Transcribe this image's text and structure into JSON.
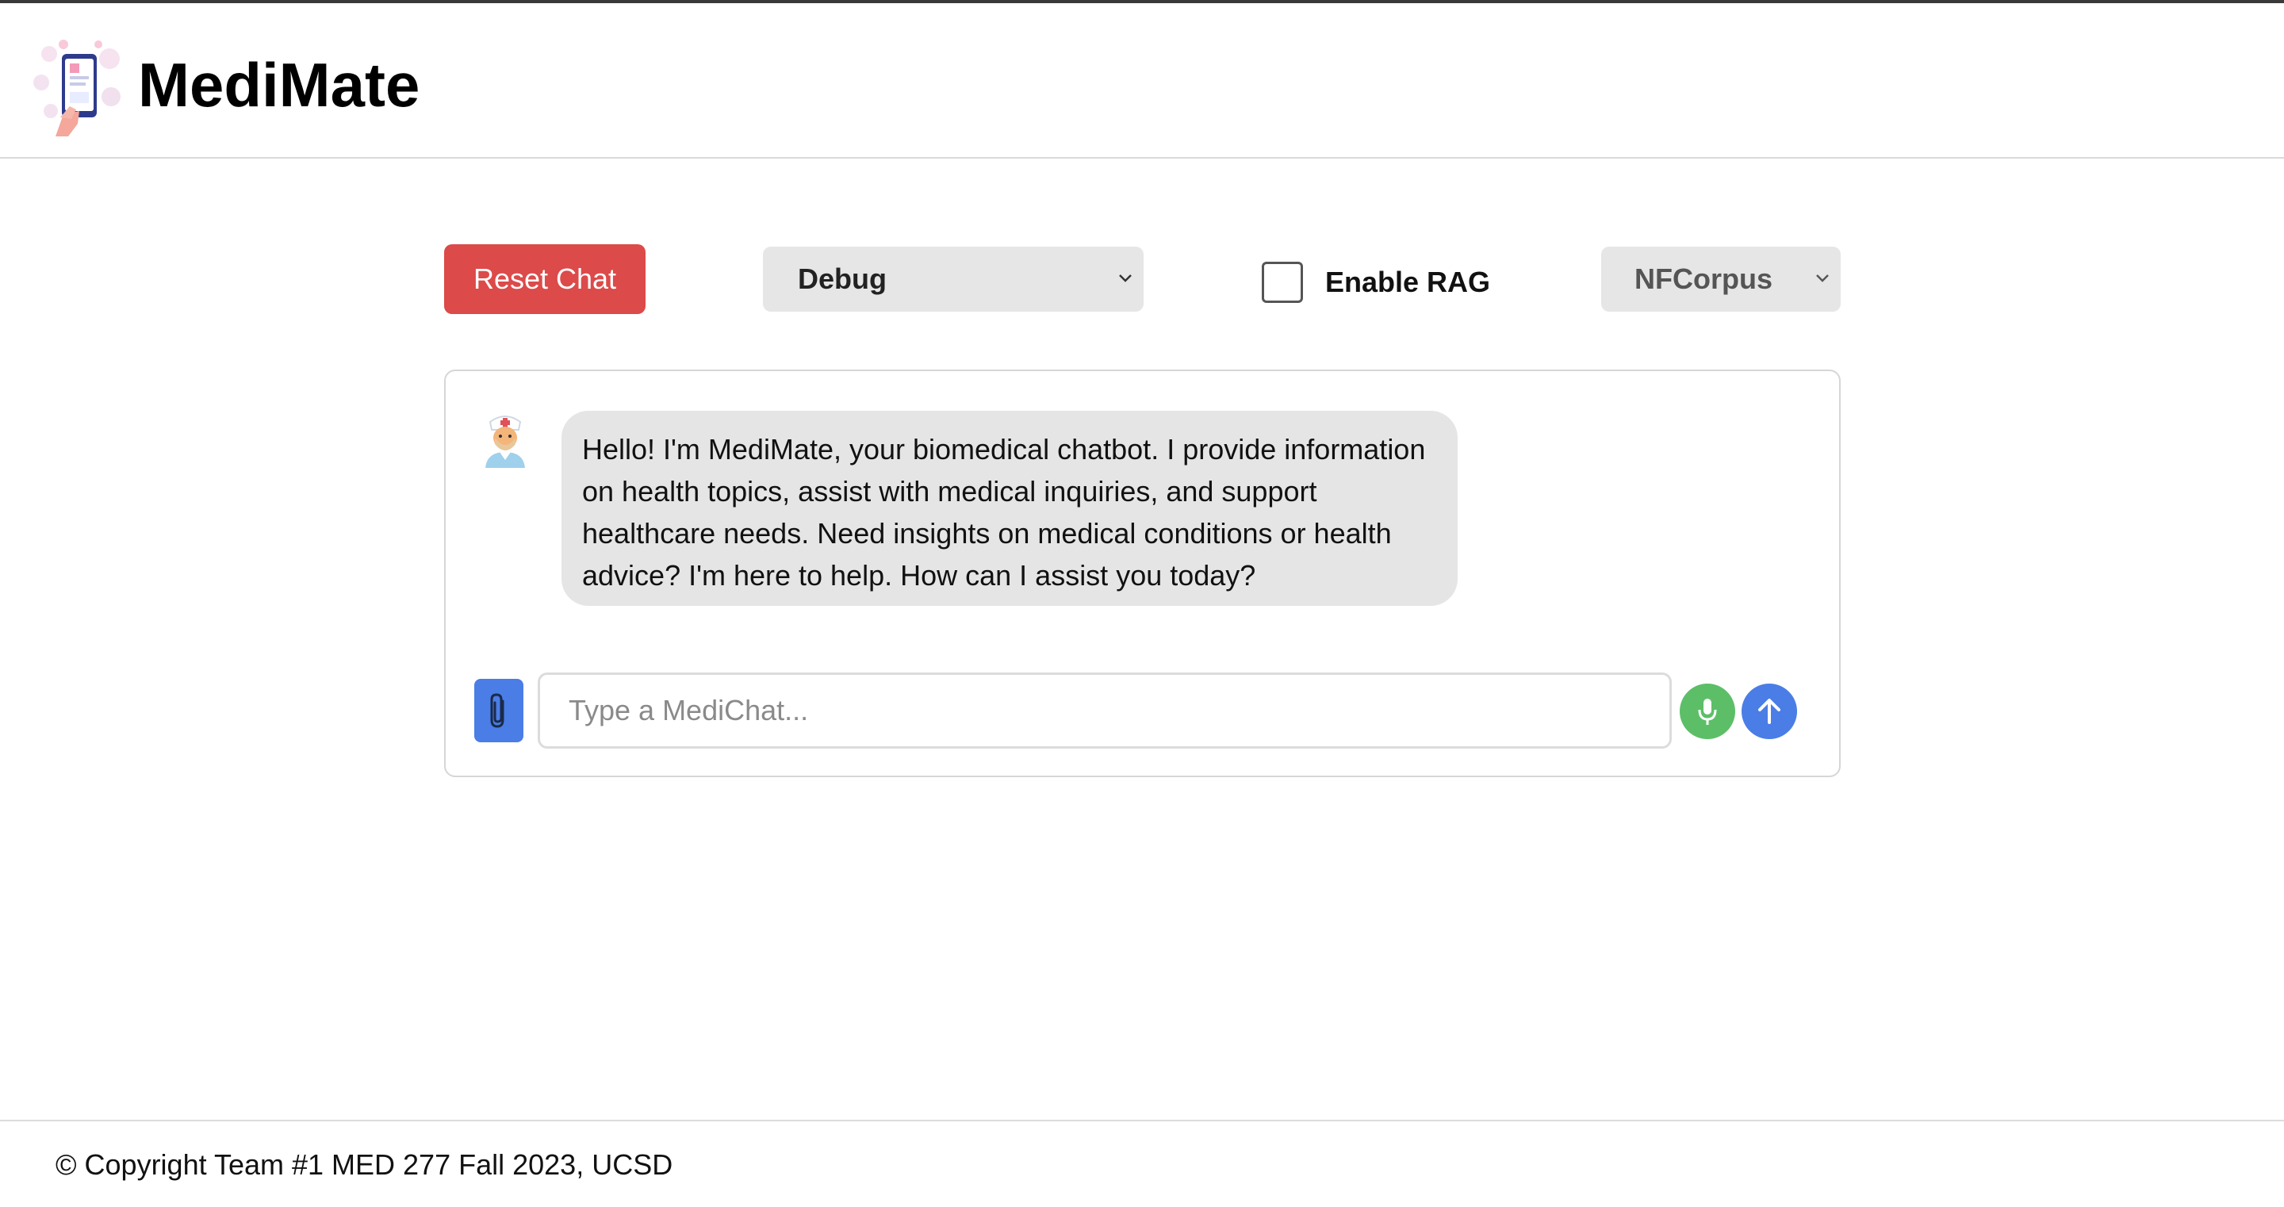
{
  "header": {
    "title": "MediMate"
  },
  "controls": {
    "reset_label": "Reset Chat",
    "mode_selected": "Debug",
    "rag_label": "Enable RAG",
    "rag_checked": false,
    "corpus_selected": "NFCorpus"
  },
  "chat": {
    "messages": [
      {
        "role": "bot",
        "text": "Hello! I'm MediMate, your biomedical chatbot. I provide information on health topics, assist with medical inquiries, and support healthcare needs. Need insights on medical conditions or health advice? I'm here to help. How can I assist you today?"
      }
    ],
    "input_value": "",
    "input_placeholder": "Type a MediChat..."
  },
  "footer": {
    "copyright": "© Copyright Team #1 MED 277 Fall 2023, UCSD"
  },
  "icons": {
    "logo": "phone-health-logo",
    "avatar": "doctor-avatar-icon",
    "attach": "paperclip-icon",
    "mic": "microphone-icon",
    "send": "arrow-up-icon",
    "dropdown": "chevron-down-icon"
  },
  "colors": {
    "reset": "#dc4a4a",
    "primary": "#4a7de6",
    "mic": "#5cbf67",
    "bubble": "#e5e5e5",
    "select_bg": "#e6e6e6"
  }
}
